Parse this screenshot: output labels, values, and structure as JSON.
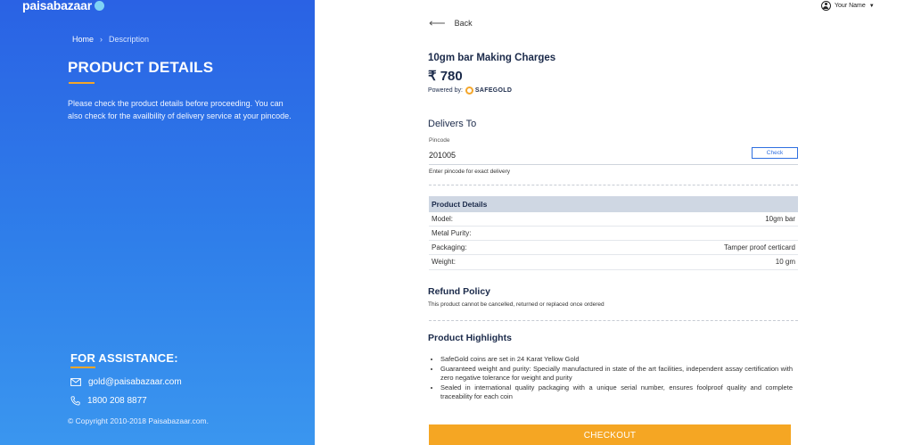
{
  "brand": {
    "logo_text": "paisabazaar"
  },
  "breadcrumb": {
    "home": "Home",
    "separator": "›",
    "current": "Description"
  },
  "left": {
    "title": "PRODUCT DETAILS",
    "description": "Please check the product details before proceeding. You can also check for the availbility of delivery service at your pincode.",
    "assistance_title": "FOR ASSISTANCE:",
    "email": "gold@paisabazaar.com",
    "phone": "1800 208 8877",
    "copyright": "© Copyright 2010-2018 Paisabazaar.com."
  },
  "user": {
    "name": "Your Name"
  },
  "main": {
    "back_label": "Back",
    "product_title": "10gm bar Making Charges",
    "price": "₹ 780",
    "powered_by_label": "Powered by:",
    "partner_name": "SAFEGOLD",
    "delivers_to": "Delivers To",
    "pincode_label": "Pincode",
    "pincode_value": "201005",
    "check_button": "Check",
    "pincode_hint": "Enter pincode for exact delivery",
    "details_header": "Product Details",
    "details": [
      {
        "label": "Model:",
        "value": "10gm bar"
      },
      {
        "label": "Metal Purity:",
        "value": ""
      },
      {
        "label": "Packaging:",
        "value": "Tamper proof certicard"
      },
      {
        "label": "Weight:",
        "value": "10 gm"
      }
    ],
    "refund_title": "Refund Policy",
    "refund_text": "This product cannot be cancelled, returned or replaced once ordered",
    "highlights_title": "Product Highlights",
    "highlights": [
      "SafeGold coins are set in 24 Karat Yellow Gold",
      "Guaranteed weight and purity: Specially manufactured in state of the art facilities, independent assay certification with zero negative tolerance for weight and purity",
      "Sealed in international quality packaging with a unique serial number, ensures foolproof quality and complete traceability for each coin"
    ],
    "checkout_button": "CHECKOUT"
  },
  "colors": {
    "accent": "#f5a623",
    "primary_blue": "#2a62e4",
    "link_blue": "#2f6fe0"
  }
}
